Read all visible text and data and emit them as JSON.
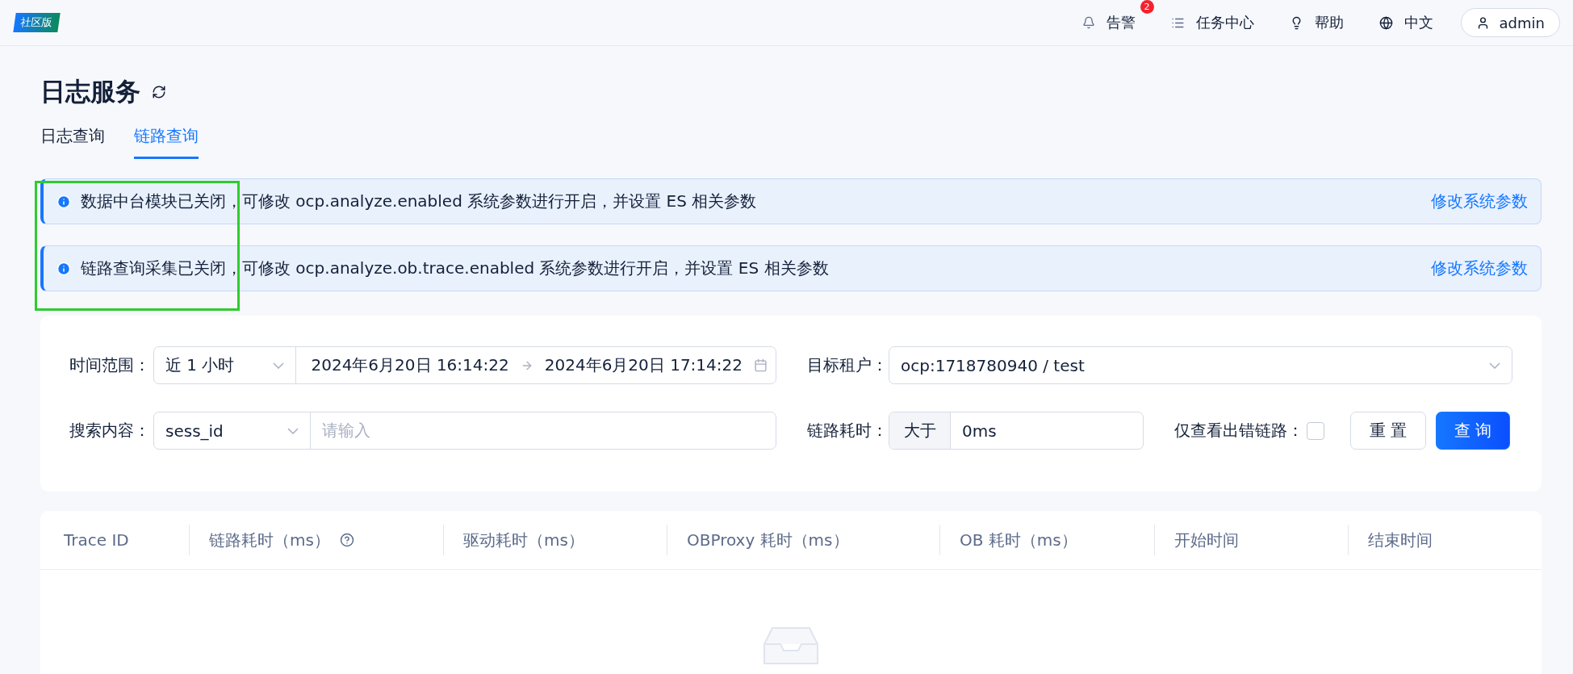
{
  "header": {
    "edition_badge": "社区版",
    "alerts": {
      "label": "告警",
      "count": "2"
    },
    "nav": [
      {
        "label": "任务中心",
        "kind": "tasks"
      },
      {
        "label": "帮助",
        "kind": "help"
      },
      {
        "label": "中文",
        "kind": "language"
      }
    ],
    "user": "admin"
  },
  "page": {
    "title": "日志服务"
  },
  "tabs": [
    {
      "label": "日志查询",
      "selected": false
    },
    {
      "label": "链路查询",
      "selected": true
    }
  ],
  "notices": [
    {
      "text": "数据中台模块已关闭，可修改 ocp.analyze.enabled 系统参数进行开启，并设置 ES 相关参数",
      "link": "修改系统参数"
    },
    {
      "text": "链路查询采集已关闭，可修改 ocp.analyze.ob.trace.enabled 系统参数进行开启，并设置 ES 相关参数",
      "link": "修改系统参数"
    }
  ],
  "filters": {
    "time_range": {
      "label": "时间范围：",
      "preset": "近 1 小时",
      "start": "2024年6月20日 16:14:22",
      "end": "2024年6月20日 17:14:22"
    },
    "tenant": {
      "label": "目标租户：",
      "value": "ocp:1718780940 / test"
    },
    "search": {
      "label": "搜索内容：",
      "field": "sess_id",
      "placeholder": "请输入"
    },
    "duration": {
      "label": "链路耗时：",
      "operator": "大于",
      "value": "0ms"
    },
    "errors_only": {
      "label": "仅查看出错链路：",
      "checked": false
    },
    "buttons": [
      {
        "label": "重 置",
        "kind": "default"
      },
      {
        "label": "查 询",
        "kind": "primary"
      }
    ]
  },
  "table": {
    "columns": [
      {
        "label": "Trace ID",
        "help": false
      },
      {
        "label": "链路耗时（ms）",
        "help": true
      },
      {
        "label": "驱动耗时（ms）",
        "help": false
      },
      {
        "label": "OBProxy 耗时（ms）",
        "help": false
      },
      {
        "label": "OB 耗时（ms）",
        "help": false
      },
      {
        "label": "开始时间",
        "help": false
      },
      {
        "label": "结束时间",
        "help": false
      }
    ]
  }
}
